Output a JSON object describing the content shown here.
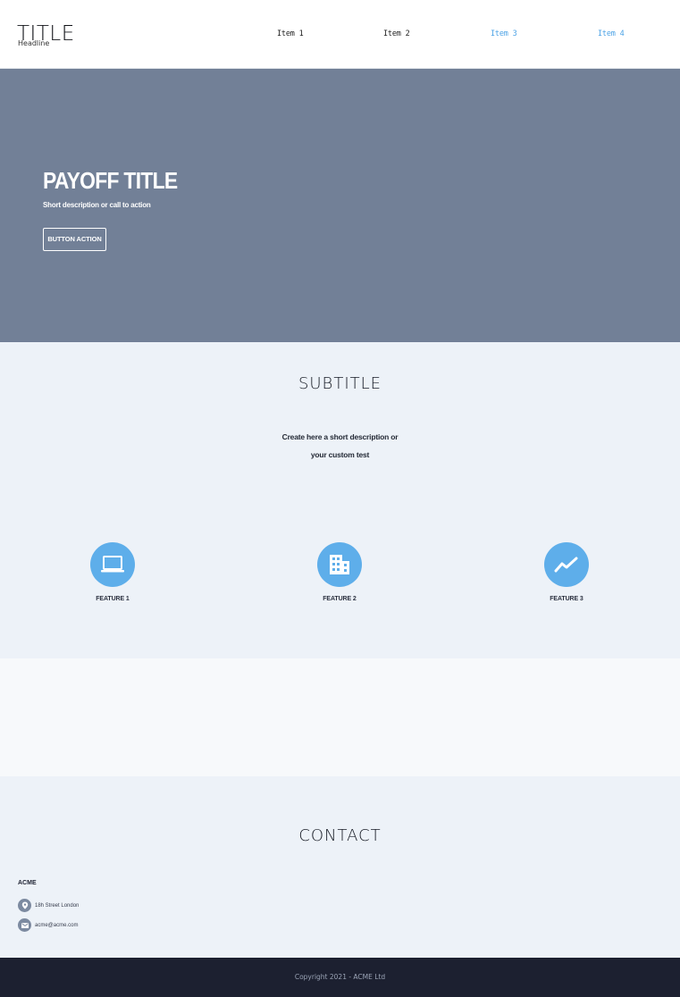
{
  "header": {
    "logo_title": "TITLE",
    "logo_subtitle": "Headline",
    "nav": [
      {
        "label": "Item 1"
      },
      {
        "label": "Item 2"
      },
      {
        "label": "Item 3"
      },
      {
        "label": "Item 4"
      }
    ],
    "accent_color": "#4da3e6"
  },
  "hero": {
    "title": "PAYOFF TITLE",
    "description": "Short description or call to action",
    "button_label": "BUTTON ACTION",
    "background_color": "#728097"
  },
  "features": {
    "title": "SUBTITLE",
    "description_line1": "Create here a short description or",
    "description_line2": "your custom test",
    "items": [
      {
        "label": "FEATURE 1",
        "icon": "laptop-icon"
      },
      {
        "label": "FEATURE 2",
        "icon": "building-icon"
      },
      {
        "label": "FEATURE 3",
        "icon": "trending-up-icon"
      }
    ],
    "icon_color": "#5eaeea"
  },
  "contact": {
    "title": "CONTACT",
    "company": "ACME",
    "address": "18h Street London",
    "email": "acme@acme.com",
    "address_icon": "location-pin-icon",
    "email_icon": "mail-icon"
  },
  "footer": {
    "copyright": "Copyright 2021 - ACME Ltd",
    "background_color": "#1c2030"
  }
}
